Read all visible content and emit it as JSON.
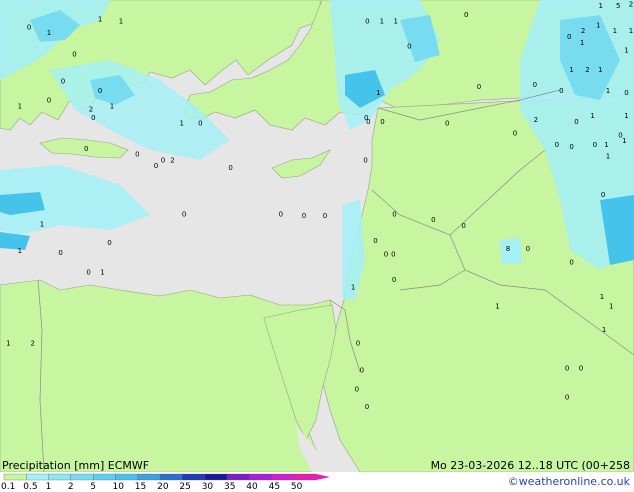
{
  "map": {
    "colors": {
      "sea": "#e6e6e6",
      "land": "#c8f5a0",
      "border": "#8a8a8a",
      "precip_light": "#a5f0f5",
      "precip_mid": "#78dcf0",
      "precip_heavy": "#46c3eb"
    },
    "point_values": [
      {
        "label": "0",
        "lon": 18.86,
        "lat": 39.69
      },
      {
        "label": "1",
        "lon": 19.86,
        "lat": 39.57
      },
      {
        "label": "0",
        "lon": 21.15,
        "lat": 39.13
      },
      {
        "label": "1",
        "lon": 22.44,
        "lat": 39.85
      },
      {
        "label": "1",
        "lon": 23.49,
        "lat": 39.81
      },
      {
        "label": "0",
        "lon": 20.57,
        "lat": 38.57
      },
      {
        "label": "0",
        "lon": 22.44,
        "lat": 38.37
      },
      {
        "label": "1",
        "lon": 18.39,
        "lat": 38.05
      },
      {
        "label": "2",
        "lon": 21.98,
        "lat": 37.99
      },
      {
        "label": "1",
        "lon": 23.04,
        "lat": 38.05
      },
      {
        "label": "0",
        "lon": 22.1,
        "lat": 37.81
      },
      {
        "label": "1",
        "lon": 26.56,
        "lat": 37.69
      },
      {
        "label": "0",
        "lon": 27.5,
        "lat": 37.69
      },
      {
        "label": "0",
        "lon": 21.74,
        "lat": 37.17
      },
      {
        "label": "0",
        "lon": 24.32,
        "lat": 37.05
      },
      {
        "label": "0",
        "lon": 25.61,
        "lat": 36.93
      },
      {
        "label": "2",
        "lon": 26.09,
        "lat": 36.93
      },
      {
        "label": "0",
        "lon": 25.26,
        "lat": 36.81
      },
      {
        "label": "0",
        "lon": 19.86,
        "lat": 38.17
      },
      {
        "label": "0",
        "lon": 29.03,
        "lat": 36.77
      },
      {
        "label": "0",
        "lon": 35.84,
        "lat": 36.93
      },
      {
        "label": "1",
        "lon": 19.51,
        "lat": 35.6
      },
      {
        "label": "1",
        "lon": 18.39,
        "lat": 35.05
      },
      {
        "label": "0",
        "lon": 20.45,
        "lat": 35.01
      },
      {
        "label": "0",
        "lon": 22.91,
        "lat": 35.21
      },
      {
        "label": "0",
        "lon": 26.68,
        "lat": 35.81
      },
      {
        "label": "0",
        "lon": 31.56,
        "lat": 35.81
      },
      {
        "label": "0",
        "lon": 32.73,
        "lat": 35.77
      },
      {
        "label": "0",
        "lon": 33.79,
        "lat": 35.77
      },
      {
        "label": "0",
        "lon": 21.86,
        "lat": 34.6
      },
      {
        "label": "1",
        "lon": 22.56,
        "lat": 34.6
      },
      {
        "label": "1",
        "lon": 17.81,
        "lat": 33.13
      },
      {
        "label": "2",
        "lon": 19.04,
        "lat": 33.13
      },
      {
        "label": "1",
        "lon": 35.21,
        "lat": 34.29
      },
      {
        "label": "0",
        "lon": 35.46,
        "lat": 33.13
      },
      {
        "label": "0",
        "lon": 35.65,
        "lat": 32.57
      },
      {
        "label": "0",
        "lon": 35.4,
        "lat": 32.17
      },
      {
        "label": "0",
        "lon": 35.91,
        "lat": 31.81
      },
      {
        "label": "0",
        "lon": 35.93,
        "lat": 39.81
      },
      {
        "label": "1",
        "lon": 36.66,
        "lat": 39.81
      },
      {
        "label": "1",
        "lon": 37.36,
        "lat": 39.81
      },
      {
        "label": "0",
        "lon": 40.92,
        "lat": 39.95
      },
      {
        "label": "0",
        "lon": 38.05,
        "lat": 39.29
      },
      {
        "label": "0",
        "lon": 41.56,
        "lat": 38.45
      },
      {
        "label": "0",
        "lon": 44.38,
        "lat": 38.49
      },
      {
        "label": "1",
        "lon": 36.49,
        "lat": 38.33
      },
      {
        "label": "0",
        "lon": 35.98,
        "lat": 37.73
      },
      {
        "label": "0",
        "lon": 36.69,
        "lat": 37.73
      },
      {
        "label": "0",
        "lon": 39.96,
        "lat": 37.69
      },
      {
        "label": "2",
        "lon": 44.43,
        "lat": 37.77
      },
      {
        "label": "0",
        "lon": 46.48,
        "lat": 37.73
      },
      {
        "label": "0",
        "lon": 45.49,
        "lat": 37.25
      },
      {
        "label": "0",
        "lon": 46.24,
        "lat": 37.21
      },
      {
        "label": "0",
        "lon": 47.41,
        "lat": 37.25
      },
      {
        "label": "1",
        "lon": 48.0,
        "lat": 37.25
      },
      {
        "label": "0",
        "lon": 43.38,
        "lat": 37.49
      },
      {
        "label": "0",
        "lon": 35.87,
        "lat": 37.81
      },
      {
        "label": "0",
        "lon": 47.83,
        "lat": 36.21
      },
      {
        "label": "0",
        "lon": 37.3,
        "lat": 35.81
      },
      {
        "label": "0",
        "lon": 39.26,
        "lat": 35.69
      },
      {
        "label": "0",
        "lon": 40.79,
        "lat": 35.57
      },
      {
        "label": "8",
        "lon": 43.03,
        "lat": 35.09
      },
      {
        "label": "0",
        "lon": 44.03,
        "lat": 35.09
      },
      {
        "label": "0",
        "lon": 36.34,
        "lat": 35.25
      },
      {
        "label": "0",
        "lon": 36.87,
        "lat": 34.97
      },
      {
        "label": "0",
        "lon": 37.24,
        "lat": 34.97
      },
      {
        "label": "0",
        "lon": 37.28,
        "lat": 34.45
      },
      {
        "label": "0",
        "lon": 46.24,
        "lat": 34.81
      },
      {
        "label": "1",
        "lon": 47.77,
        "lat": 34.09
      },
      {
        "label": "1",
        "lon": 48.24,
        "lat": 33.89
      },
      {
        "label": "1",
        "lon": 42.5,
        "lat": 33.89
      },
      {
        "label": "1",
        "lon": 47.88,
        "lat": 33.41
      },
      {
        "label": "0",
        "lon": 46.01,
        "lat": 32.61
      },
      {
        "label": "0",
        "lon": 46.71,
        "lat": 32.61
      },
      {
        "label": "0",
        "lon": 46.01,
        "lat": 32.01
      },
      {
        "label": "1",
        "lon": 47.71,
        "lat": 40.13
      },
      {
        "label": "5",
        "lon": 48.59,
        "lat": 40.13
      },
      {
        "label": "2",
        "lon": 49.24,
        "lat": 40.17
      },
      {
        "label": "1",
        "lon": 47.58,
        "lat": 39.73
      },
      {
        "label": "2",
        "lon": 46.82,
        "lat": 39.61
      },
      {
        "label": "1",
        "lon": 48.42,
        "lat": 39.61
      },
      {
        "label": "1",
        "lon": 49.24,
        "lat": 39.61
      },
      {
        "label": "0",
        "lon": 46.12,
        "lat": 39.49
      },
      {
        "label": "1",
        "lon": 46.77,
        "lat": 39.37
      },
      {
        "label": "1",
        "lon": 49.01,
        "lat": 39.21
      },
      {
        "label": "1",
        "lon": 46.24,
        "lat": 38.81
      },
      {
        "label": "2",
        "lon": 47.04,
        "lat": 38.81
      },
      {
        "label": "1",
        "lon": 47.69,
        "lat": 38.81
      },
      {
        "label": "0",
        "lon": 45.72,
        "lat": 38.37
      },
      {
        "label": "1",
        "lon": 48.07,
        "lat": 38.37
      },
      {
        "label": "0",
        "lon": 49.01,
        "lat": 38.33
      },
      {
        "label": "1",
        "lon": 47.3,
        "lat": 37.85
      },
      {
        "label": "1",
        "lon": 49.01,
        "lat": 37.85
      },
      {
        "label": "1",
        "lon": 48.9,
        "lat": 37.33
      },
      {
        "label": "1",
        "lon": 48.07,
        "lat": 37.01
      },
      {
        "label": "0",
        "lon": 48.71,
        "lat": 37.45
      }
    ]
  },
  "footer": {
    "title": "Precipitation [mm]  ECMWF",
    "run": "Mo 23-03-2026 12..18 UTC (00+258",
    "credit": "©weatheronline.co.uk",
    "legend": [
      {
        "label": "0.1",
        "color": "#c8f5a0"
      },
      {
        "label": "0.5",
        "color": "#a5f0f5"
      },
      {
        "label": "1",
        "color": "#8ee6f3"
      },
      {
        "label": "2",
        "color": "#78dcf0"
      },
      {
        "label": "5",
        "color": "#5fcfee"
      },
      {
        "label": "10",
        "color": "#46c3eb"
      },
      {
        "label": "15",
        "color": "#3aa0e0"
      },
      {
        "label": "20",
        "color": "#2a6fcc"
      },
      {
        "label": "25",
        "color": "#1e3cb4"
      },
      {
        "label": "30",
        "color": "#1a1a96"
      },
      {
        "label": "35",
        "color": "#7a1ec8"
      },
      {
        "label": "40",
        "color": "#aa1edc"
      },
      {
        "label": "45",
        "color": "#d21ed2"
      },
      {
        "label": "50",
        "color": "#e61eb4"
      }
    ]
  }
}
